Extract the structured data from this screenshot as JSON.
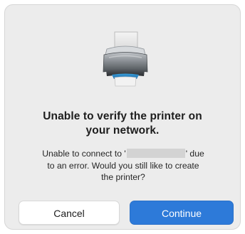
{
  "dialog": {
    "icon": "printer-icon",
    "title_line1": "Unable to verify the printer on",
    "title_line2": "your network.",
    "message_part1": "Unable to connect to '",
    "message_part2": "' due",
    "message_line2": "to an error. Would you still like to create",
    "message_line3": "the printer?",
    "cancel_label": "Cancel",
    "continue_label": "Continue"
  },
  "colors": {
    "dialog_bg": "#ececec",
    "primary_button": "#2d7ad9",
    "redaction": "#d3d3d3"
  }
}
